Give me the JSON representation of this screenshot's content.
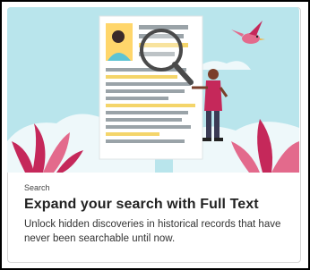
{
  "card": {
    "eyebrow": "Search",
    "title": "Expand your search with Full Text",
    "description": "Unlock hidden discoveries in historical records that have never been searchable until now."
  },
  "illustration": {
    "icons": [
      "document-icon",
      "magnifier-icon",
      "person-icon",
      "bird-icon",
      "plant-icon",
      "cloud-icon"
    ],
    "colors": {
      "sky": "#b9e5ec",
      "cloud": "#eef8fa",
      "accent": "#c5285a",
      "highlight": "#f4d56a",
      "paper": "#ffffff"
    }
  }
}
